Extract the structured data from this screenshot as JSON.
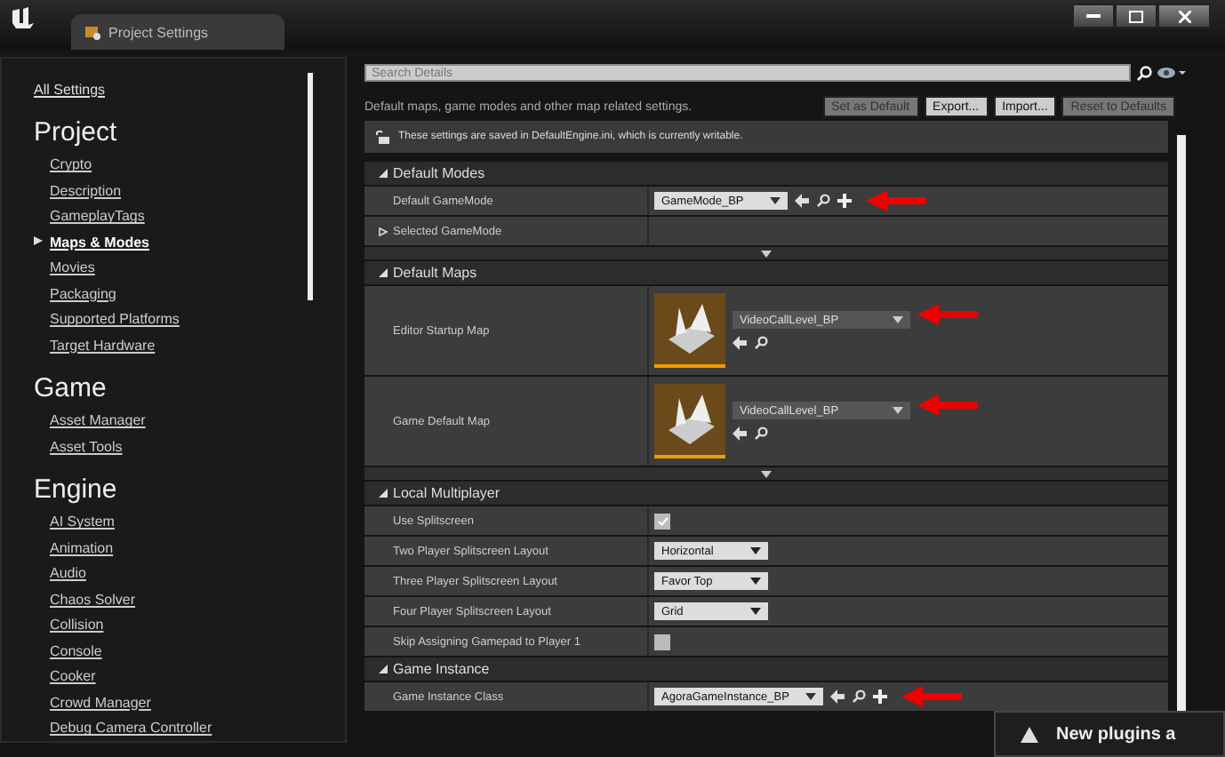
{
  "window": {
    "tab_title": "Project Settings"
  },
  "sidebar": {
    "all_settings": "All Settings",
    "sections": [
      {
        "title": "Project",
        "items": [
          {
            "label": "Crypto",
            "selected": false
          },
          {
            "label": "Description",
            "selected": false
          },
          {
            "label": "GameplayTags",
            "selected": false
          },
          {
            "label": "Maps & Modes",
            "selected": true
          },
          {
            "label": "Movies",
            "selected": false
          },
          {
            "label": "Packaging",
            "selected": false
          },
          {
            "label": "Supported Platforms",
            "selected": false
          },
          {
            "label": "Target Hardware",
            "selected": false
          }
        ]
      },
      {
        "title": "Game",
        "items": [
          {
            "label": "Asset Manager",
            "selected": false
          },
          {
            "label": "Asset Tools",
            "selected": false
          }
        ]
      },
      {
        "title": "Engine",
        "items": [
          {
            "label": "AI System",
            "selected": false
          },
          {
            "label": "Animation",
            "selected": false
          },
          {
            "label": "Audio",
            "selected": false
          },
          {
            "label": "Chaos Solver",
            "selected": false
          },
          {
            "label": "Collision",
            "selected": false
          },
          {
            "label": "Console",
            "selected": false
          },
          {
            "label": "Cooker",
            "selected": false
          },
          {
            "label": "Crowd Manager",
            "selected": false
          },
          {
            "label": "Debug Camera Controller",
            "selected": false
          }
        ]
      }
    ]
  },
  "details": {
    "search": {
      "placeholder": "Search Details"
    },
    "description": "Default maps, game modes and other map related settings.",
    "buttons": [
      {
        "label": "Set as Default",
        "disabled": true
      },
      {
        "label": "Export...",
        "disabled": false
      },
      {
        "label": "Import...",
        "disabled": false
      },
      {
        "label": "Reset to Defaults",
        "disabled": true
      }
    ],
    "info": "These settings are saved in DefaultEngine.ini, which is currently writable.",
    "sections": [
      {
        "title": "Default Modes",
        "advanced": true,
        "rows": [
          {
            "kind": "class",
            "label": "Default GameMode",
            "value": "GameMode_BP",
            "highlighted": true
          },
          {
            "kind": "group",
            "label": "Selected GameMode",
            "expanded": false
          }
        ]
      },
      {
        "title": "Default Maps",
        "advanced": true,
        "rows": [
          {
            "kind": "map",
            "label": "Editor Startup Map",
            "value": "VideoCallLevel_BP",
            "highlighted": true
          },
          {
            "kind": "map",
            "label": "Game Default Map",
            "value": "VideoCallLevel_BP",
            "highlighted": true
          }
        ]
      },
      {
        "title": "Local Multiplayer",
        "advanced": false,
        "rows": [
          {
            "kind": "checkbox",
            "label": "Use Splitscreen",
            "checked": true
          },
          {
            "kind": "combo",
            "label": "Two Player Splitscreen Layout",
            "value": "Horizontal"
          },
          {
            "kind": "combo",
            "label": "Three Player Splitscreen Layout",
            "value": "Favor Top"
          },
          {
            "kind": "combo",
            "label": "Four Player Splitscreen Layout",
            "value": "Grid"
          },
          {
            "kind": "checkbox",
            "label": "Skip Assigning Gamepad to Player 1",
            "checked": false
          }
        ]
      },
      {
        "title": "Game Instance",
        "advanced": false,
        "rows": [
          {
            "kind": "class",
            "label": "Game Instance Class",
            "value": "AgoraGameInstance_BP",
            "highlighted": true
          }
        ]
      }
    ]
  },
  "notification": {
    "text": "New plugins a"
  }
}
